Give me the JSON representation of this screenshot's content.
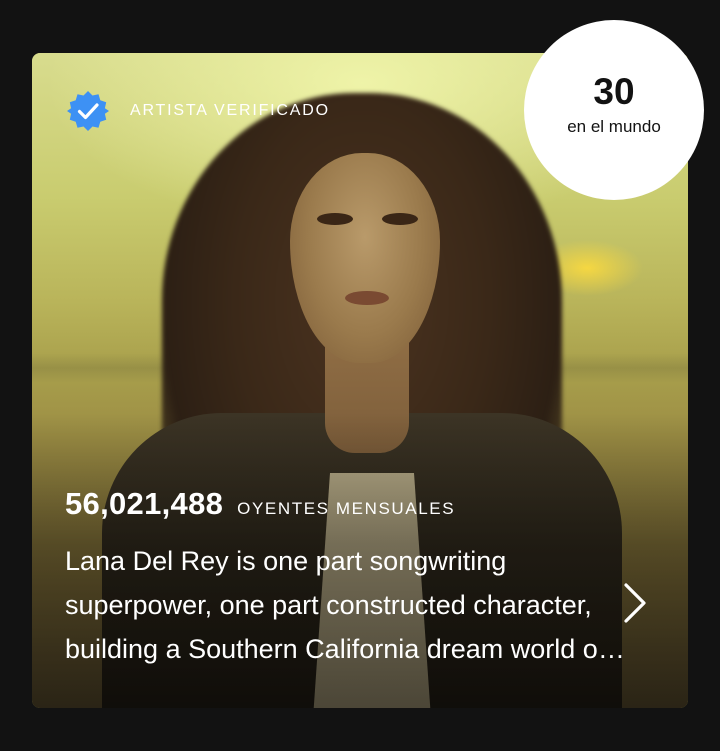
{
  "card": {
    "verified_label": "ARTISTA VERIFICADO",
    "monthly_listeners_count": "56,021,488",
    "monthly_listeners_label": "OYENTES MENSUALES",
    "bio": "Lana Del Rey is one part songwriting superpower, one part constructed character, building a Southern California dream world out of Hollywood noir, Americana kitsch, and melancholy pop.",
    "icons": {
      "verified": "verified-badge-icon",
      "open": "chevron-right-icon"
    }
  },
  "rank": {
    "number": "30",
    "label": "en el mundo"
  },
  "colors": {
    "background": "#121212",
    "verified_blue": "#3d91f4",
    "text": "#ffffff",
    "bubble": "#ffffff"
  }
}
